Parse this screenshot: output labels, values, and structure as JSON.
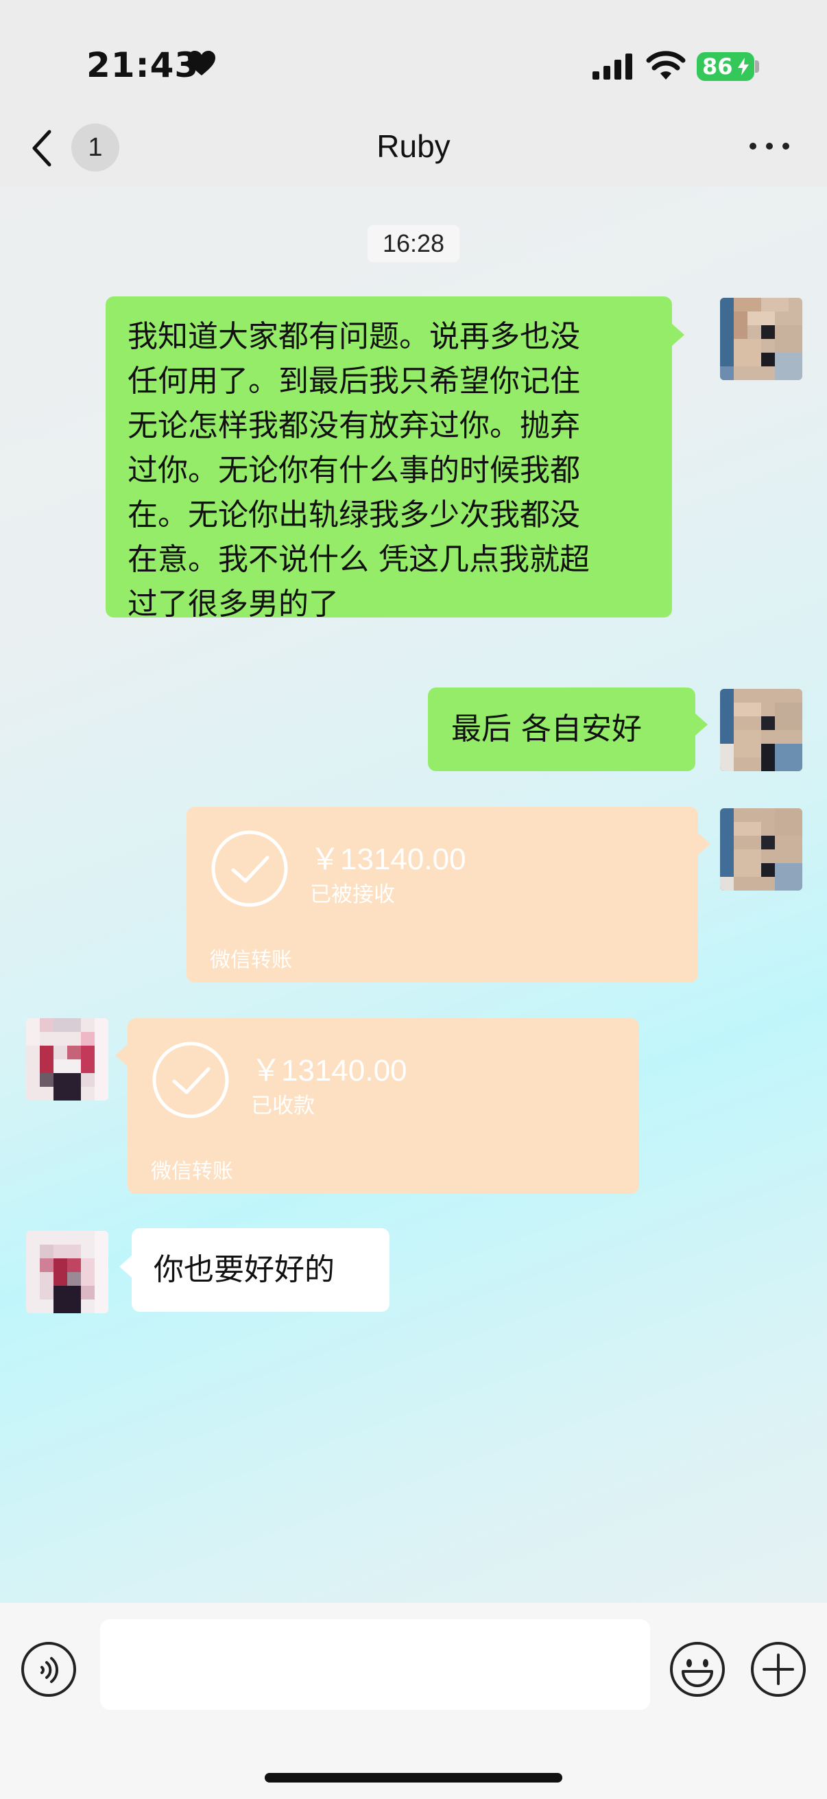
{
  "status_bar": {
    "time": "21:43",
    "heart_icon": "heart-icon",
    "battery": "86",
    "battery_color": "#34c759"
  },
  "header": {
    "back_icon": "chevron-left-icon",
    "unread_count": "1",
    "title": "Ruby",
    "more_icon": "ellipsis-icon"
  },
  "chat": {
    "timestamp": "16:28",
    "messages": [
      {
        "side": "right",
        "type": "text",
        "lines": [
          "我知道大家都有问题。说再多也没",
          "任何用了。到最后我只希望你记住",
          "无论怎样我都没有放弃过你。抛弃",
          "过你。无论你有什么事的时候我都",
          "在。无论你出轨绿我多少次我都没",
          "在意。我不说什么 凭这几点我就超",
          "过了很多男的了"
        ]
      },
      {
        "side": "right",
        "type": "text",
        "text": "最后 各自安好"
      },
      {
        "side": "right",
        "type": "transfer",
        "amount": "￥13140.00",
        "status": "已被接收",
        "label": "微信转账"
      },
      {
        "side": "left",
        "type": "transfer",
        "amount": "￥13140.00",
        "status": "已收款",
        "label": "微信转账"
      },
      {
        "side": "left",
        "type": "text",
        "text": "你也要好好的"
      }
    ]
  },
  "input_bar": {
    "voice_icon": "voice-icon",
    "emoji_icon": "emoji-icon",
    "plus_icon": "plus-icon",
    "placeholder": ""
  },
  "colors": {
    "sent_bubble": "#95ec69",
    "received_bubble": "#ffffff",
    "transfer_bubble": "#fde0c2"
  }
}
